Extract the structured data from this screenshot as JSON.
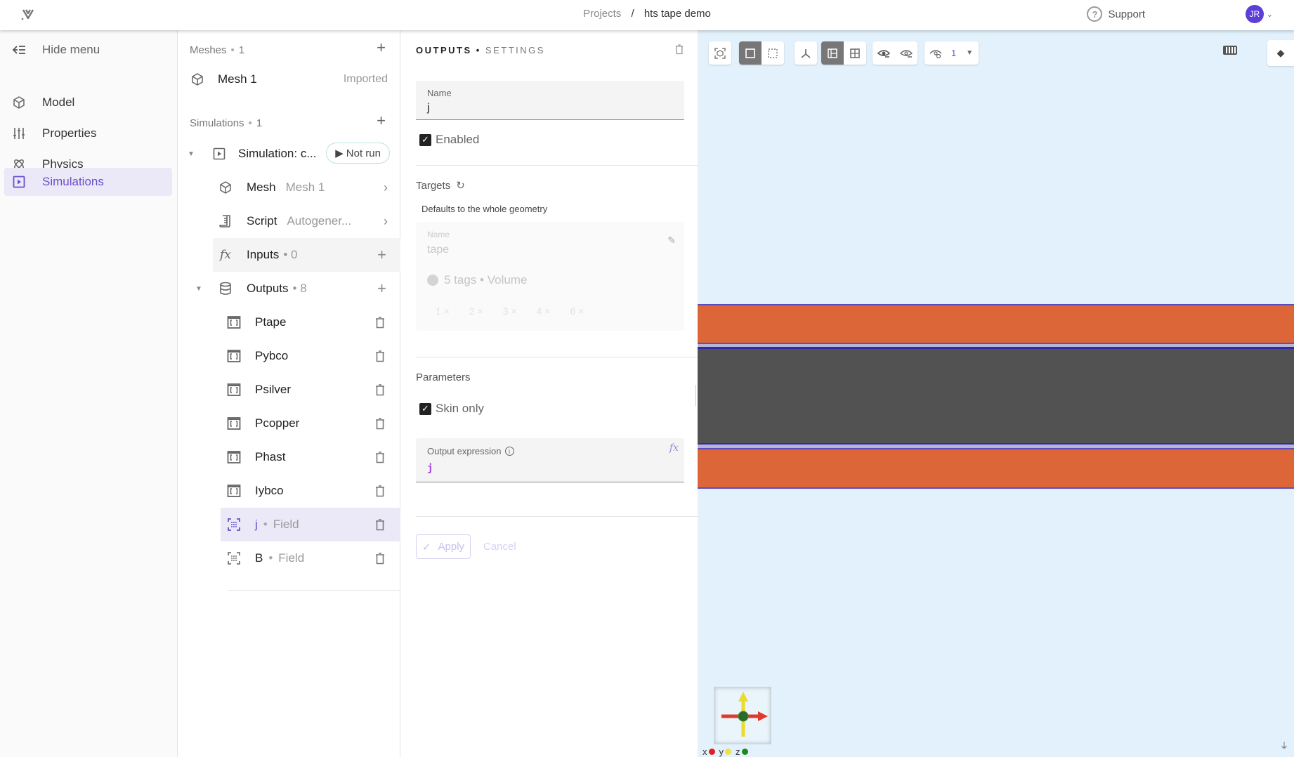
{
  "header": {
    "logo": "app-logo",
    "breadcrumb": {
      "parent": "Projects",
      "separator": "/",
      "current": "hts tape demo"
    },
    "support_label": "Support",
    "user_initials": "JR"
  },
  "sidebar": {
    "hide_menu": "Hide menu",
    "items": [
      {
        "label": "Model",
        "icon": "cube-icon"
      },
      {
        "label": "Properties",
        "icon": "sliders-icon"
      },
      {
        "label": "Physics",
        "icon": "atom-icon"
      },
      {
        "label": "Simulations",
        "icon": "play-square-icon",
        "active": true
      }
    ]
  },
  "tree": {
    "meshes": {
      "title": "Meshes",
      "count": "1"
    },
    "mesh_item": {
      "label": "Mesh 1",
      "status": "Imported"
    },
    "simulations": {
      "title": "Simulations",
      "count": "1"
    },
    "simulation": {
      "label": "Simulation: c...",
      "status": "Not run"
    },
    "children": {
      "mesh": {
        "label": "Mesh",
        "value": "Mesh 1"
      },
      "script": {
        "label": "Script",
        "value": "Autogener..."
      },
      "inputs": {
        "label": "Inputs",
        "count": "• 0"
      },
      "outputs": {
        "label": "Outputs",
        "count": "• 8"
      }
    },
    "outputs": [
      {
        "label": "Ptape",
        "type": ""
      },
      {
        "label": "Pybco",
        "type": ""
      },
      {
        "label": "Psilver",
        "type": ""
      },
      {
        "label": "Pcopper",
        "type": ""
      },
      {
        "label": "Phast",
        "type": ""
      },
      {
        "label": "Iybco",
        "type": ""
      },
      {
        "label": "j",
        "type": "Field",
        "selected": true
      },
      {
        "label": "B",
        "type": "Field"
      }
    ]
  },
  "settings": {
    "title": "OUTPUTS",
    "subtitle": "SETTINGS",
    "name_label": "Name",
    "name_value": "j",
    "enabled_label": "Enabled",
    "enabled": true,
    "targets_label": "Targets",
    "targets_hint": "Defaults to the whole geometry",
    "target_card": {
      "name_label": "Name",
      "name_value": "tape",
      "tags_summary": "5 tags • Volume",
      "tags": [
        "1 ×",
        "2 ×",
        "3 ×",
        "4 ×",
        "6 ×"
      ]
    },
    "parameters_label": "Parameters",
    "skin_only_label": "Skin only",
    "skin_only": true,
    "expression_label": "Output expression",
    "expression_value": "j",
    "fx_label": "fx",
    "apply_label": "Apply",
    "cancel_label": "Cancel"
  },
  "viewer": {
    "layer_number": "1",
    "axis_legend": {
      "x": "x",
      "y": "y",
      "z": "z"
    },
    "colors": {
      "background": "#e2f1fb",
      "orange_layer": "#dd6638",
      "dark_layer": "#525252",
      "edge": "#4a3fb0",
      "accent": "#6a4fc8"
    }
  }
}
